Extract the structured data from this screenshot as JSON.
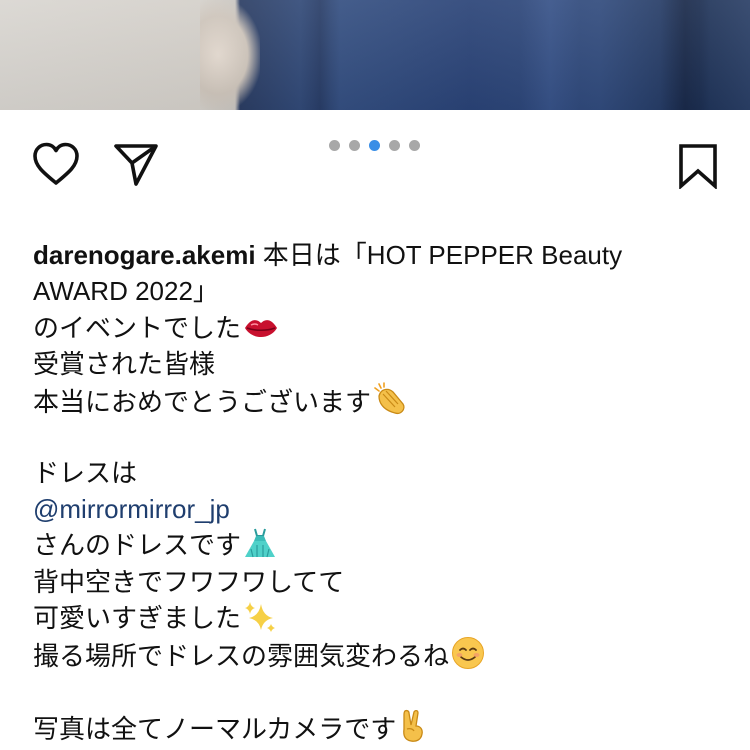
{
  "post": {
    "carousel": {
      "count": 5,
      "active_index": 2,
      "active_color": "#3a8ee6",
      "inactive_color": "#a8a8a8"
    },
    "actions": {
      "like_icon": "heart-outline-icon",
      "share_icon": "paper-plane-icon",
      "save_icon": "bookmark-outline-icon"
    },
    "caption": {
      "username": "darenogare.akemi",
      "line1_text": "本日は「HOT PEPPER Beauty",
      "line2_text": "AWARD 2022」",
      "line3_text": "のイベントでした",
      "line3_emoji": "lips-icon",
      "line4_text": "受賞された皆様",
      "line5_text": "本当におめでとうございます",
      "line5_emoji": "clapping-hands-icon",
      "line6_text": "ドレスは",
      "mention": "@mirrormirror_jp",
      "mention_color": "#1f3e6e",
      "line8_text": "さんのドレスです",
      "line8_emoji": "dress-icon",
      "line9_text": "背中空きでフワフワしてて",
      "line10_text": "可愛いすぎました",
      "line10_emoji": "sparkles-icon",
      "line11_text": "撮る場所でドレスの雰囲気変わるね",
      "line11_emoji": "smiling-face-icon",
      "line12_text": "写真は全てノーマルカメラです",
      "line12_emoji": "victory-hand-icon"
    }
  }
}
